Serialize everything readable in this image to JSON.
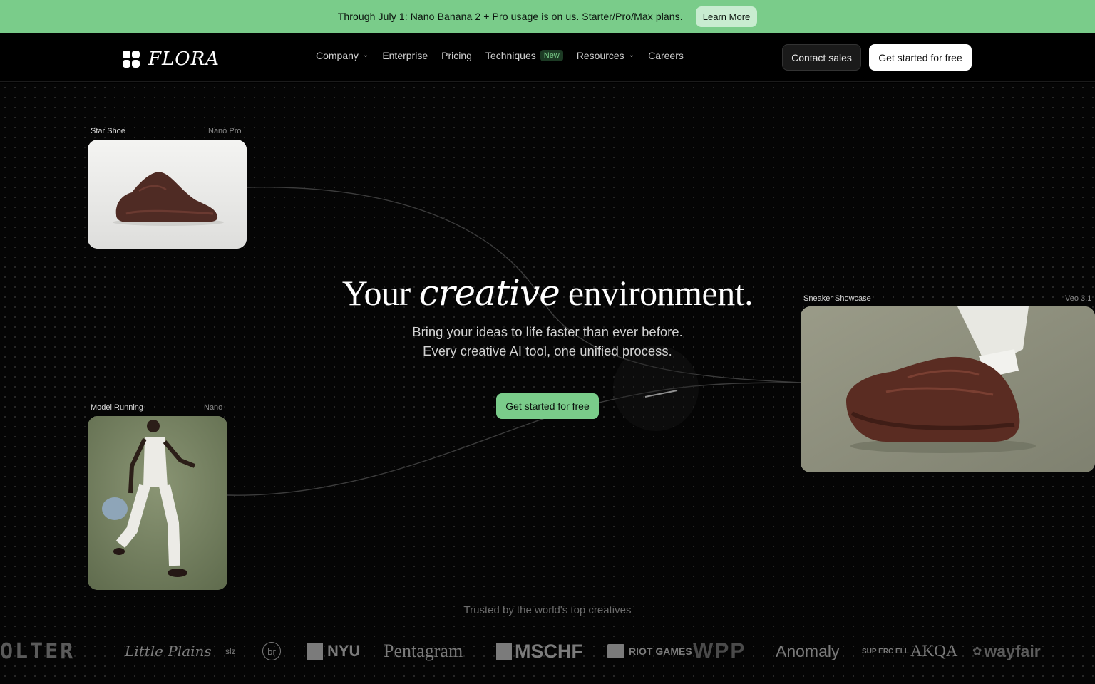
{
  "banner": {
    "text": "Through July 1: Nano Banana 2 + Pro usage is on us. Starter/Pro/Max plans.",
    "button": "Learn More"
  },
  "nav": {
    "brand": "FLORA",
    "links": {
      "company": "Company",
      "enterprise": "Enterprise",
      "pricing": "Pricing",
      "techniques": "Techniques",
      "techniques_badge": "New",
      "resources": "Resources",
      "careers": "Careers"
    },
    "contact": "Contact sales",
    "get_started": "Get started for free"
  },
  "nodes": {
    "star_shoe": {
      "label": "Star Shoe",
      "model": "Nano Pro"
    },
    "model_running": {
      "label": "Model Running",
      "model": "Nano"
    },
    "sneaker_showcase": {
      "label": "Sneaker Showcase",
      "model": "Veo 3.1"
    }
  },
  "hero": {
    "title_before": "Your",
    "title_italic": "creative",
    "title_after": "environment.",
    "subtitle_line1": "Bring your ideas to life faster than ever before.",
    "subtitle_line2": "Every creative AI tool, one unified process.",
    "cta": "Get started for free"
  },
  "trusted": {
    "heading": "Trusted by the world's top creatives",
    "logos": [
      "OLTER",
      "Little Plains",
      "slz",
      "br",
      "NYU",
      "Pentagram",
      "MSCHF",
      "RIOT GAMES",
      "WPP",
      "Anomaly",
      "SUP ERC ELL",
      "AKQA",
      "wayfair"
    ]
  },
  "colors": {
    "accent_green": "#7acc8a",
    "background": "#000000"
  }
}
